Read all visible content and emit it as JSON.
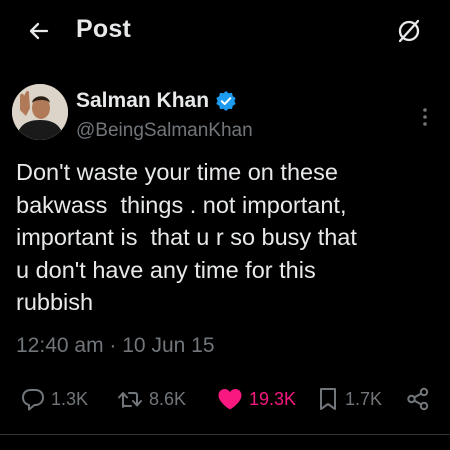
{
  "header": {
    "title": "Post",
    "back_icon": "arrow-left-icon",
    "grok_icon": "grok-icon"
  },
  "author": {
    "name": "Salman Khan",
    "handle": "@BeingSalmanKhan",
    "verified": true,
    "verified_color": "#1d9bf0",
    "avatar_icon": "avatar"
  },
  "post": {
    "text": "Don't waste your time on these\nbakwass  things . not important,\nimportant is  that u r so busy that\nu don't have any time for this\nrubbish",
    "time": "12:40 am",
    "separator": "·",
    "date": "10 Jun 15"
  },
  "actions": {
    "replies": "1.3K",
    "reposts": "8.6K",
    "likes": "19.3K",
    "bookmarks": "1.7K",
    "liked": true,
    "like_color": "#f91880"
  },
  "colors": {
    "background": "#000000",
    "text_primary": "#e7e9ea",
    "text_secondary": "#71767b",
    "divider": "#2f3336"
  }
}
